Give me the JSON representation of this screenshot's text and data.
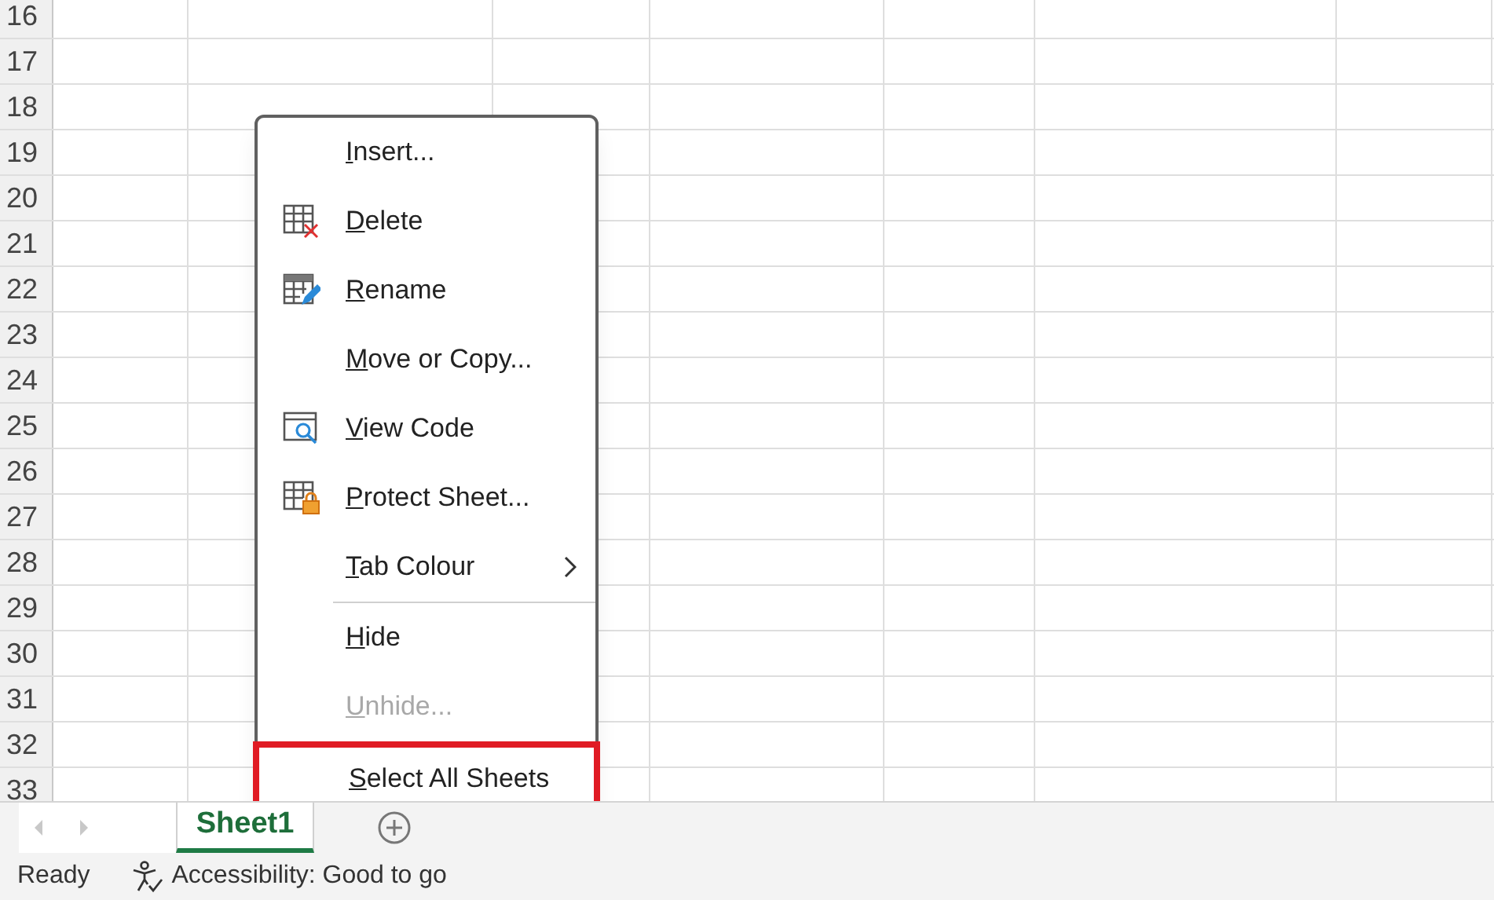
{
  "grid": {
    "row_numbers": [
      "16",
      "17",
      "18",
      "19",
      "20",
      "21",
      "22",
      "23",
      "24",
      "25",
      "26",
      "27",
      "28",
      "29",
      "30",
      "31",
      "32",
      "33"
    ]
  },
  "context_menu": {
    "items": [
      {
        "label": "Insert...",
        "disabled": false,
        "outlined": false
      },
      {
        "label": "Delete",
        "kind": "delete",
        "disabled": false,
        "outlined": false
      },
      {
        "label": "Rename",
        "kind": "rename",
        "disabled": false,
        "outlined": false
      },
      {
        "label": "Move or Copy...",
        "disabled": false,
        "outlined": false
      },
      {
        "label": "View Code",
        "kind": "view-code",
        "disabled": false,
        "outlined": false
      },
      {
        "label": "Protect Sheet...",
        "kind": "protect",
        "disabled": false,
        "outlined": false
      },
      {
        "label": "Tab Colour",
        "submenu": true,
        "separator_after": true,
        "disabled": false,
        "outlined": false
      },
      {
        "label": "Hide",
        "disabled": false,
        "outlined": false
      },
      {
        "label": "Unhide...",
        "disabled": true,
        "outlined": false
      },
      {
        "label": "Select All Sheets",
        "disabled": false,
        "outlined": true
      }
    ]
  },
  "sheet_tabs": [
    {
      "label": "Sheet1",
      "selected": true
    }
  ],
  "status_bar": {
    "mode": "Ready",
    "accessibility": "Accessibility: Good to go"
  }
}
